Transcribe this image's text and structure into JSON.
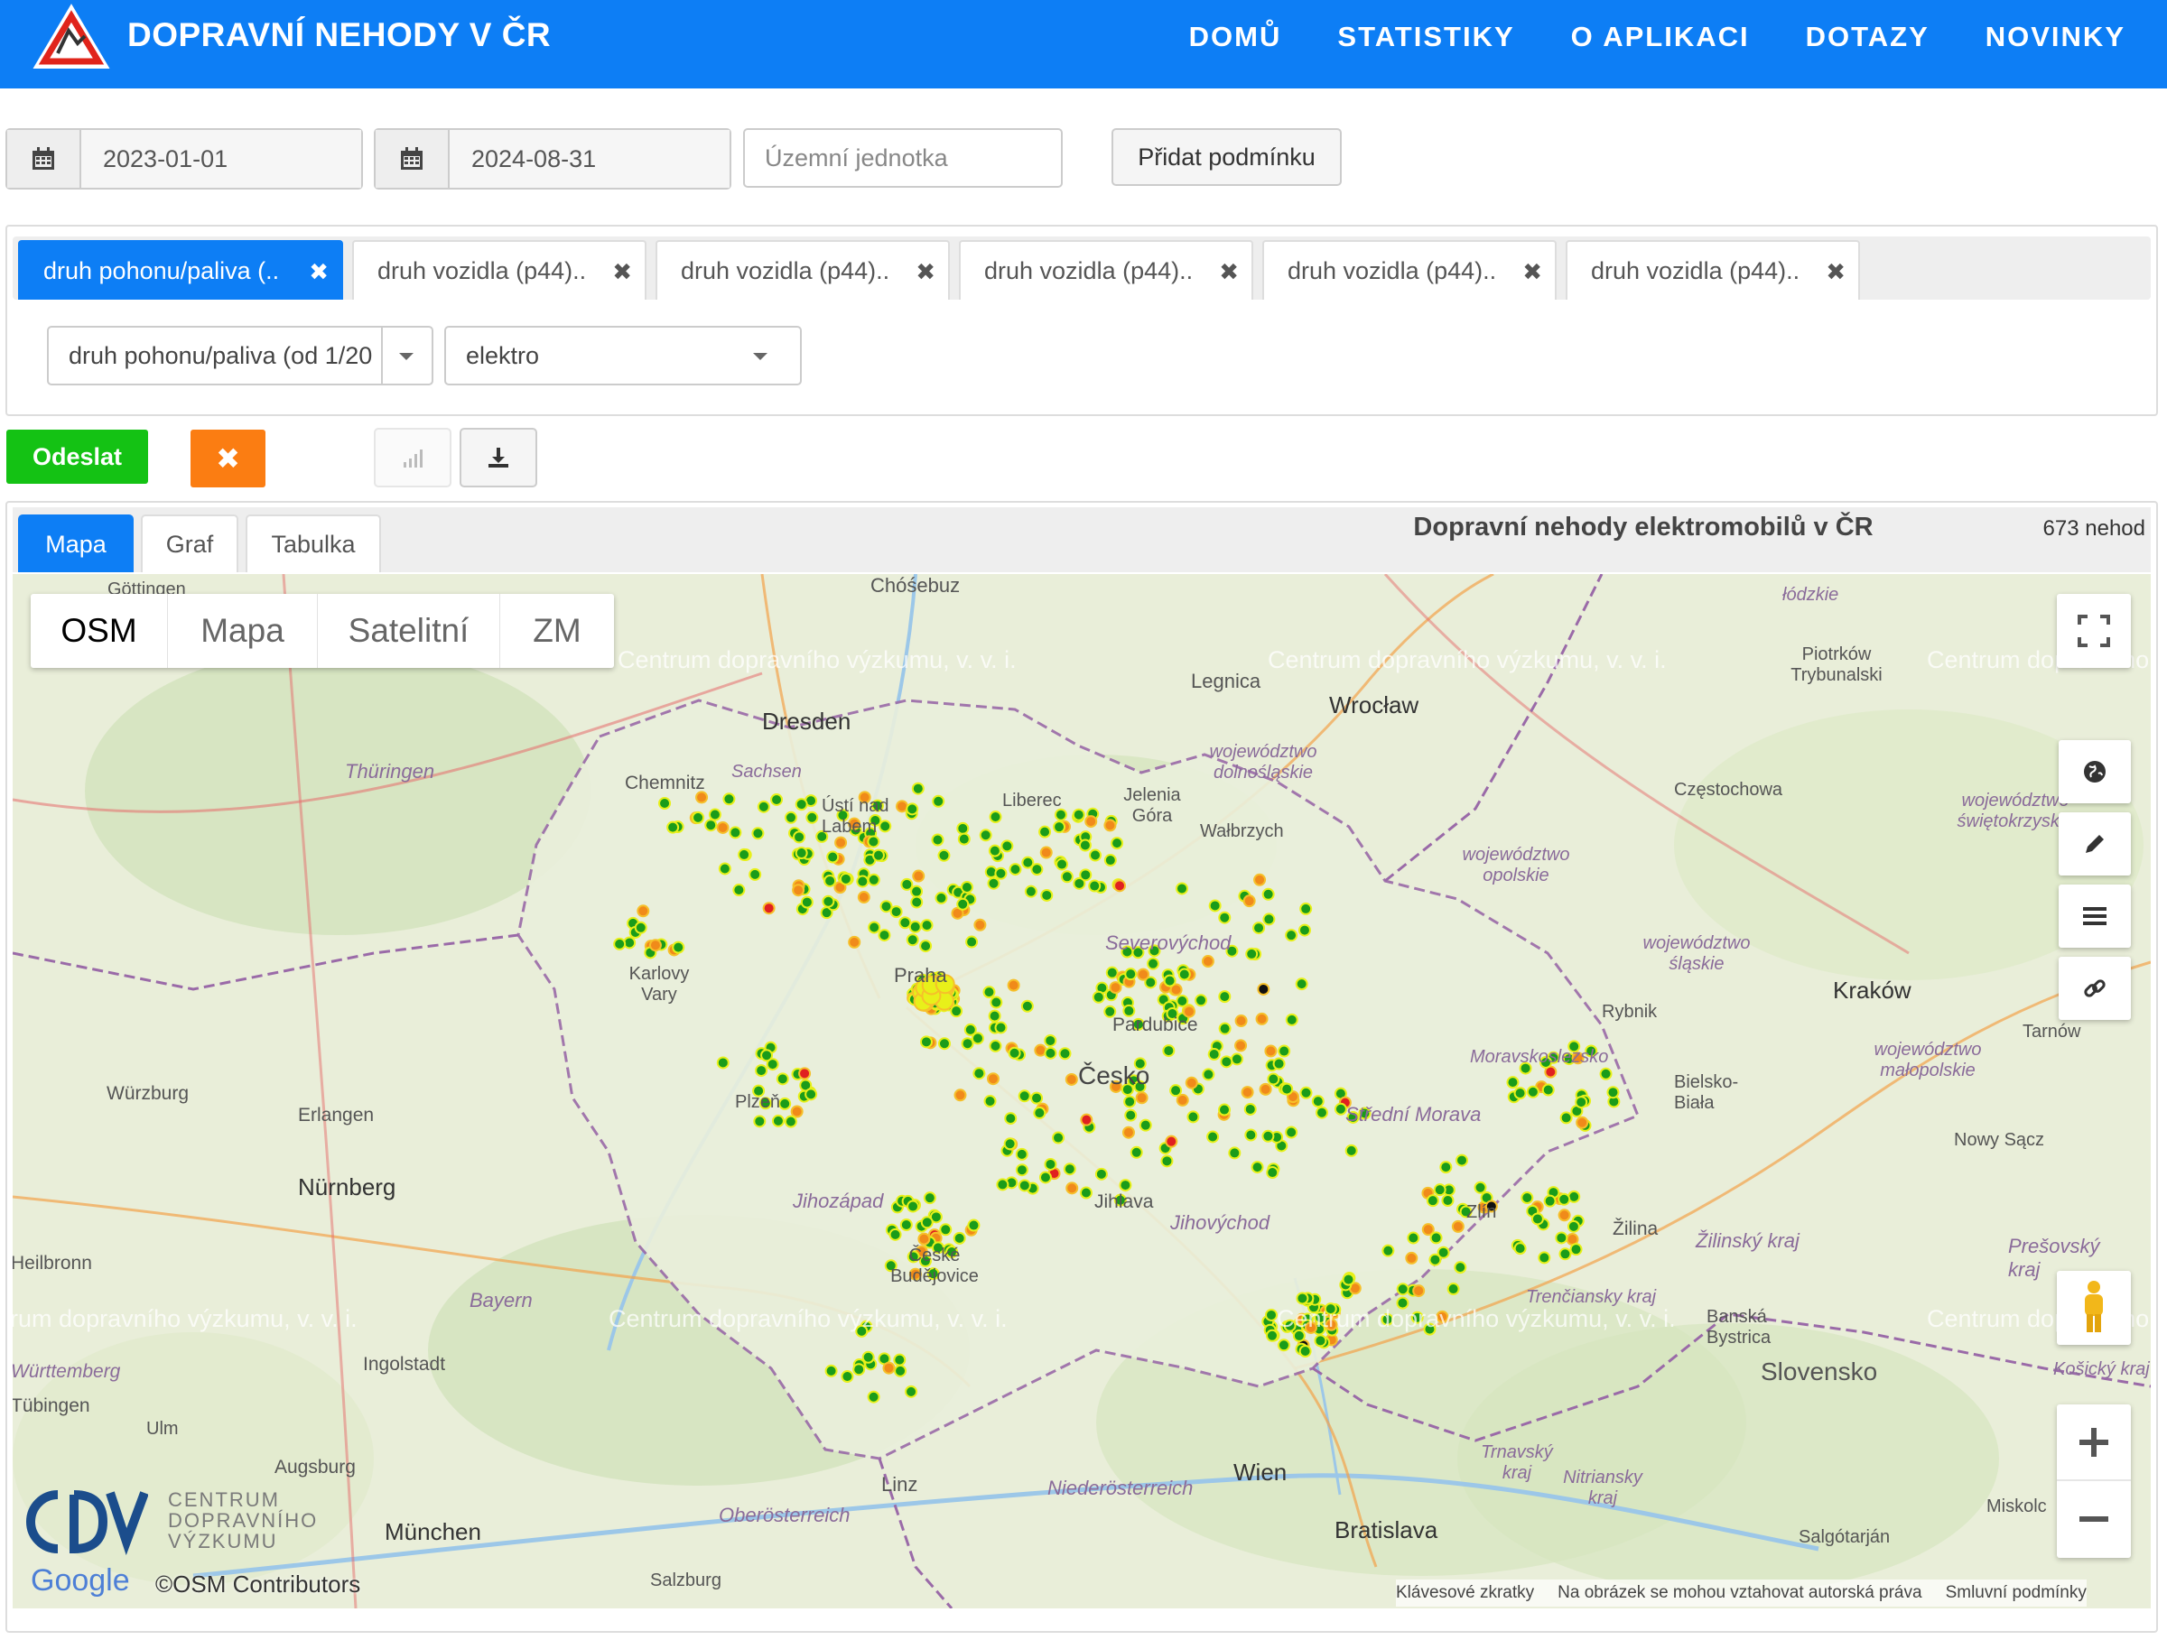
{
  "header": {
    "brand": "DOPRAVNÍ NEHODY V ČR",
    "nav": [
      "DOMŮ",
      "STATISTIKY",
      "O APLIKACI",
      "DOTAZY",
      "NOVINKY"
    ],
    "colors": {
      "navbar": "#0d7ef5",
      "primary": "#0d7ef5",
      "success": "#14c214",
      "warning": "#fb7d12"
    }
  },
  "filters": {
    "date_from": "2023-01-01",
    "date_to": "2024-08-31",
    "territory_placeholder": "Územní jednotka",
    "add_condition": "Přidat podmínku"
  },
  "conditions": {
    "tags": [
      "druh pohonu/paliva (..",
      "druh vozidla (p44)..",
      "druh vozidla (p44)..",
      "druh vozidla (p44)..",
      "druh vozidla (p44)..",
      "druh vozidla (p44).."
    ],
    "active_tag": 0,
    "field_select": "druh pohonu/paliva (od 1/20",
    "value_select": "elektro"
  },
  "actions": {
    "submit": "Odeslat",
    "clear_icon": "times-icon",
    "chart_icon": "bar-chart-icon",
    "download_icon": "download-icon"
  },
  "results": {
    "tabs": [
      "Mapa",
      "Graf",
      "Tabulka"
    ],
    "active_tab": "Mapa",
    "title": "Dopravní nehody elektromobilů v ČR",
    "count": "673 nehod"
  },
  "map": {
    "layers": [
      "OSM",
      "Mapa",
      "Satelitní",
      "ZM"
    ],
    "active_layer": "OSM",
    "right_controls": [
      "fullscreen-icon",
      "globe-icon",
      "pencil-icon",
      "menu-icon",
      "link-icon",
      "pegman-icon",
      "zoom-in-icon",
      "zoom-out-icon"
    ],
    "labels": {
      "chosebuz": "Chóśebuz",
      "gottingen": "Göttingen",
      "lodzkie": "łódzkie",
      "legnica": "Legnica",
      "wroclaw": "Wrocław",
      "piotrkow": "Piotrków Trybunalski",
      "dresden": "Dresden",
      "chemnitz": "Chemnitz",
      "sachsen": "Sachsen",
      "thuringen": "Thüringen",
      "usti": "Ústí nad Labem",
      "liberec": "Liberec",
      "jelenia": "Jelenia Góra",
      "walbrzych": "Wałbrzych",
      "dolnoslaskie": "województwo dolnośląskie",
      "czestochowa": "Częstochowa",
      "swietokrzyskie": "województwo świętokrzyskie",
      "opolskie": "województwo opolskie",
      "slaskie": "województwo śląskie",
      "krakow": "Kraków",
      "malopolskie": "województwo małopolskie",
      "tarnow": "Tarnów",
      "severovychod": "Severovýchod",
      "karlovy": "Karlovy Vary",
      "praha": "Praha",
      "pardubice": "Pardubice",
      "cesko": "Česko",
      "rybnik": "Rybnik",
      "moravskoslezsko": "Moravskoslezsko",
      "bielsko": "Bielsko-Biała",
      "nowysacz": "Nowy Sącz",
      "wurzburg": "Würzburg",
      "erlangen": "Erlangen",
      "plzen": "Plzeň",
      "strednimorava": "Střední Morava",
      "nurnberg": "Nürnberg",
      "jihlava": "Jihlava",
      "jihozapad": "Jihozápad",
      "jihovychod": "Jihovýchod",
      "zlin": "Zlín",
      "zilina": "Žilina",
      "zilinskykraj": "Žilinský kraj",
      "presovsky": "Prešovský kraj",
      "heilbronn": "Heilbronn",
      "bayern": "Bayern",
      "ceskebudejovice": "České Budějovice",
      "trenciansky": "Trenčiansky kraj",
      "banska": "Banská Bystrica",
      "wurttemberg": "Württemberg",
      "ingolstadt": "Ingolstadt",
      "slovensko": "Slovensko",
      "kosicky": "Košický kraj",
      "ulm": "Ulm",
      "augsburg": "Augsburg",
      "linz": "Linz",
      "niederosterreich": "Niederösterreich",
      "wien": "Wien",
      "trnavsky": "Trnavský kraj",
      "nitriansky": "Nitriansky kraj",
      "miskolc": "Miskolc",
      "munchen": "München",
      "oberosterreich": "Oberösterreich",
      "bratislava": "Bratislava",
      "salgotarjan": "Salgótarján",
      "salzburg": "Salzburg",
      "tubingen": "Tübingen"
    },
    "watermarks": [
      "Centrum dopravního výzkumu, v. v. i.",
      "Centrum dopravního výzkumu, v. v. i.",
      "Centrum dopravního výzkumu, v. v. i.",
      "Centrum dopravního výzkumu, v. v. i.",
      "Centrum dopravního výzkumu, v. v. i.",
      "Centrum dopravního výzkumu, v. v. i.",
      "Centrum dopravního výzkumu, v. v. i.",
      "Centrum dopravního výzkumu, v. v. i."
    ],
    "cdv_logo": "CENTRUM DOPRAVNÍHO VÝZKUMU",
    "google": "Google",
    "osm_credit": "©OSM Contributors",
    "footer_links": [
      "Klávesové zkratky",
      "Na obrázek se mohou vztahovat autorská práva",
      "Smluvní podmínky"
    ],
    "marker_colors": {
      "green": "#1a9c1a",
      "orange": "#f08a1a",
      "red": "#e02020",
      "black": "#111111",
      "yellow": "#e8f01a"
    }
  }
}
